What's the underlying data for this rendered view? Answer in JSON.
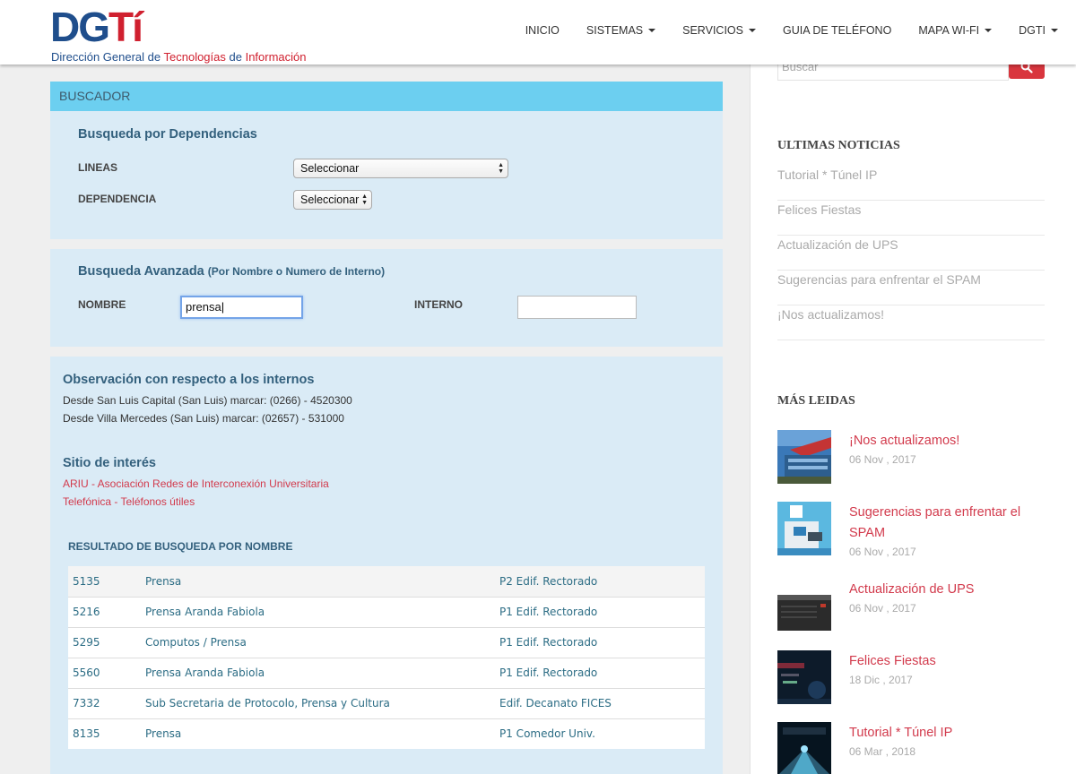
{
  "logo": {
    "dg": "DG",
    "ti": "Tí",
    "sub_part1": "Dirección General de ",
    "sub_part2": "Tecnologías",
    "sub_part3": " de ",
    "sub_part4": "Información"
  },
  "nav": {
    "inicio": "INICIO",
    "sistemas": "SISTEMAS",
    "servicios": "SERVICIOS",
    "guia": "GUIA DE TELÉFONO",
    "mapa": "MAPA WI-FI",
    "dgti": "DGTI"
  },
  "buscador": {
    "header": "BUSCADOR"
  },
  "dependencias": {
    "title": "Busqueda por Dependencias",
    "lineas_label": "LINEAS",
    "lineas_value": "Seleccionar",
    "dependencia_label": "DEPENDENCIA",
    "dependencia_value": "Seleccionar"
  },
  "avanzada": {
    "title": "Busqueda Avanzada",
    "subtitle": "(Por Nombre o Numero de Interno)",
    "nombre_label": "NOMBRE",
    "nombre_value": "prensa",
    "interno_label": "INTERNO",
    "interno_value": ""
  },
  "observacion": {
    "title": "Observación con respecto a los internos",
    "line1": "Desde San Luis Capital (San Luis) marcar: (0266) - 4520300",
    "line2": "Desde Villa Mercedes (San Luis) marcar: (02657) - 531000"
  },
  "interes": {
    "title": "Sitio de interés",
    "link1": "ARIU - Asociación Redes de Interconexión Universitaria",
    "link2": "Telefónica - Teléfonos útiles"
  },
  "resultado": {
    "title": "RESULTADO DE BUSQUEDA POR NOMBRE",
    "rows": [
      {
        "interno": "5135",
        "nombre": "Prensa",
        "ubicacion": "P2 Edif. Rectorado"
      },
      {
        "interno": "5216",
        "nombre": "Prensa Aranda Fabiola",
        "ubicacion": "P1 Edif. Rectorado"
      },
      {
        "interno": "5295",
        "nombre": "Computos / Prensa",
        "ubicacion": "P1 Edif. Rectorado"
      },
      {
        "interno": "5560",
        "nombre": "Prensa Aranda Fabiola",
        "ubicacion": "P1 Edif. Rectorado"
      },
      {
        "interno": "7332",
        "nombre": "Sub Secretaria de Protocolo, Prensa y Cultura",
        "ubicacion": "Edif. Decanato FICES"
      },
      {
        "interno": "8135",
        "nombre": "Prensa",
        "ubicacion": "P1 Comedor Univ."
      }
    ]
  },
  "sidebar": {
    "search_placeholder": "Buscar",
    "ultimas_title": "ULTIMAS NOTICIAS",
    "ultimas": [
      "Tutorial * Túnel IP",
      "Felices Fiestas",
      "Actualización de UPS",
      "Sugerencias para enfrentar el SPAM",
      "¡Nos actualizamos!"
    ],
    "mas_title": "MÁS LEIDAS",
    "mas": [
      {
        "title": "¡Nos actualizamos!",
        "date": "06 Nov , 2017"
      },
      {
        "title": "Sugerencias para enfrentar el SPAM",
        "date": "06 Nov , 2017"
      },
      {
        "title": "Actualización de UPS",
        "date": "06 Nov , 2017"
      },
      {
        "title": "Felices Fiestas",
        "date": "18 Dic , 2017"
      },
      {
        "title": "Tutorial * Túnel IP",
        "date": "06 Mar , 2018"
      }
    ]
  },
  "colors": {
    "header_blue": "#6ccff0",
    "panel_blue": "#daebf6",
    "accent_red": "#d23a4c",
    "logo_blue": "#1f4e8c"
  }
}
